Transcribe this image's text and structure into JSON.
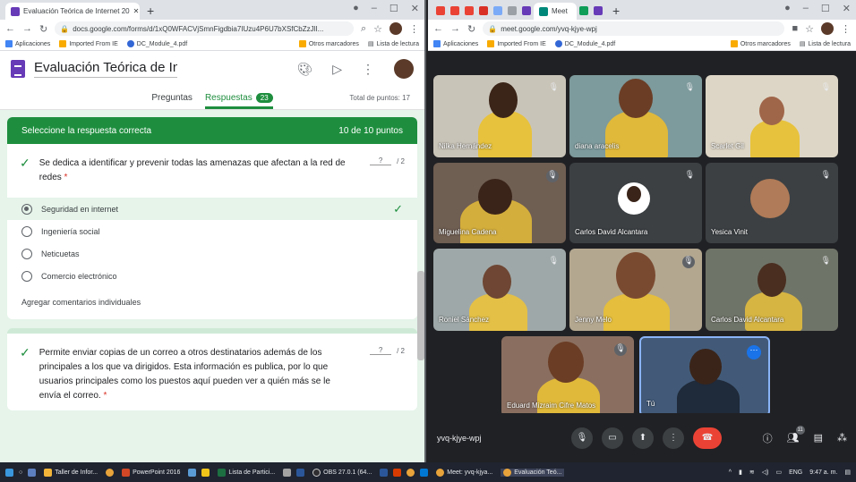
{
  "left_browser": {
    "tab_title": "Evaluación Teórica de Internet 20",
    "url": "docs.google.com/forms/d/1xQ0WFACVjSmnFigdbia7IUzu4P6U7bXSfCbZzJlI...",
    "bookmarks": [
      "Aplicaciones",
      "Imported From IE",
      "DC_Module_4.pdf",
      "Otros marcadores",
      "Lista de lectura"
    ]
  },
  "form": {
    "title": "Evaluación Teórica de Inter",
    "tab_questions": "Preguntas",
    "tab_responses": "Respuestas",
    "responses_count": "23",
    "total_points": "Total de puntos: 17",
    "section_title": "Seleccione la respuesta correcta",
    "section_points": "10 de 10 puntos",
    "q1": {
      "text": "Se dedica a identificar y prevenir todas las amenazas que afectan a la red de redes",
      "required": "*",
      "score": "?",
      "max": "/ 2",
      "options": [
        "Seguridad en internet",
        "Ingeniería social",
        "Neticuetas",
        "Comercio electrónico"
      ]
    },
    "feedback_link": "Agregar comentarios individuales",
    "q2": {
      "text": "Permite enviar copias de un correo a otros destinatarios además de los principales a los que va dirigidos. Esta información es publica, por lo que usuarios principales como los puestos aquí pueden ver a quién más se le envía el correo.",
      "required": "*",
      "score": "?",
      "max": "/ 2"
    }
  },
  "right_browser": {
    "tab_title": "Meet - yvq-kjye-wpj",
    "url": "meet.google.com/yvq-kjye-wpj",
    "bookmarks": [
      "Aplicaciones",
      "Imported From IE",
      "DC_Module_4.pdf",
      "Otros marcadores",
      "Lista de lectura"
    ]
  },
  "meet": {
    "participants": [
      "Nilka Hernández",
      "diana aracelis",
      "Scarlet Gil",
      "Miguelina Cadena",
      "Carlos David Alcantara",
      "Yesica Vinit",
      "Roniel Sánchez",
      "Jenny Melo",
      "Carlos David Alcantara",
      "Eduard Mizraim Cifre Matos",
      "Tú"
    ],
    "meeting_code": "yvq-kjye-wpj",
    "people_count": "11"
  },
  "taskbar": {
    "items": [
      "Taller de Infor...",
      "PowerPoint 2016",
      "Lista de Partici...",
      "OBS 27.0.1 (64...",
      "Meet: yvq-kjya...",
      "Evaluación Teó..."
    ],
    "lang": "ENG",
    "time": "9:47 a. m."
  },
  "colors": {
    "forms_purple": "#673ab7",
    "forms_green": "#1e8e3e",
    "meet_dark": "#202124",
    "end_call_red": "#ea4335"
  }
}
